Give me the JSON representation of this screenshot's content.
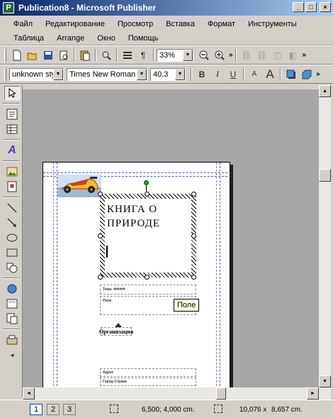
{
  "window": {
    "title": "Publication8 - Microsoft Publisher",
    "app_icon": "P",
    "controls": {
      "minimize": "_",
      "maximize": "□",
      "close": "×"
    }
  },
  "menu": {
    "row1": [
      "Файл",
      "Редактирование",
      "Просмотр",
      "Вставка",
      "Формат",
      "Инструменты"
    ],
    "row2": [
      "Таблица",
      "Arrange",
      "Окно",
      "Помощь"
    ]
  },
  "standard_toolbar": {
    "zoom": "33%",
    "icons": [
      "new-icon",
      "open-icon",
      "save-icon",
      "print-preview-icon",
      "paste-icon",
      "search-icon",
      "columns-icon",
      "pilcrow-icon",
      "zoom-out-icon",
      "zoom-in-icon",
      "overflow-icon",
      "link-icon",
      "unlink-icon",
      "disconnect-icon",
      "connect-icon"
    ]
  },
  "format_toolbar": {
    "style": "unknown sty",
    "font": "Times New Roman",
    "size": "40,3",
    "bold": "B",
    "italic": "I",
    "underline": "U",
    "shrink_font": "A",
    "grow_font": "A"
  },
  "document": {
    "heading": "КНИГА О ПРИРОДЕ",
    "small_label_1": "Тема: ######",
    "small_label_2": "Поле",
    "org_label": "Организация",
    "small_label_3": "Адрес",
    "small_label_4": "Город Страна"
  },
  "tooltip": "Поле",
  "status": {
    "pages": [
      "1",
      "2",
      "3"
    ],
    "position": "6,500; 4,000 cm.",
    "size_w": "10,076 x",
    "size_h": "8,657 cm."
  }
}
